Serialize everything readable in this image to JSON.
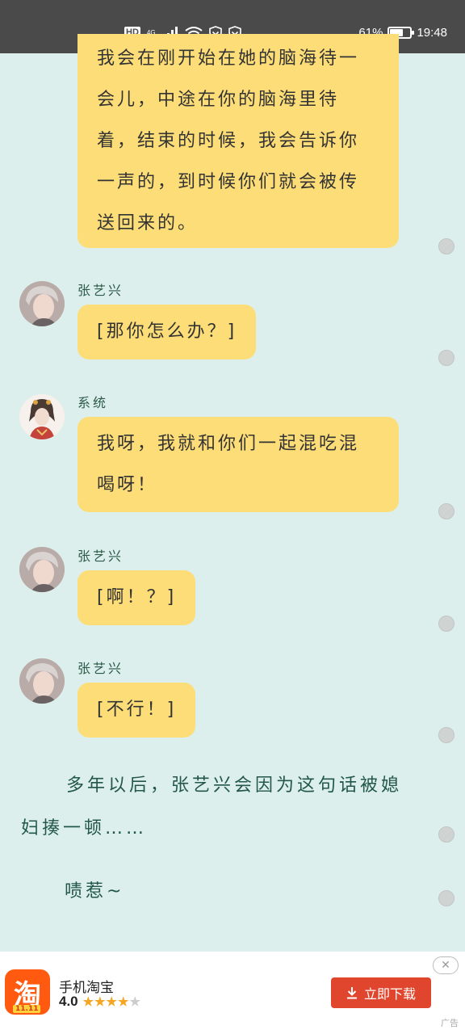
{
  "status_bar": {
    "hd": "HD",
    "network": "4G",
    "battery_text": "61%",
    "battery_level": 0.61,
    "time": "19:48"
  },
  "messages": [
    {
      "lines": [
        "我会在刚开始在她的脑海待一",
        "会儿，中途在你的脑海里待",
        "着，结束的时候，我会告诉你",
        "一声的，到时候你们就会被传",
        "送回来的。"
      ]
    },
    {
      "sender": "张艺兴",
      "lines": [
        "[那你怎么办？]"
      ]
    },
    {
      "sender": "系统",
      "lines": [
        "我呀，我就和你们一起混吃混",
        "喝呀！"
      ]
    },
    {
      "sender": "张艺兴",
      "lines": [
        "[啊！？]"
      ]
    },
    {
      "sender": "张艺兴",
      "lines": [
        "[不行！]"
      ]
    }
  ],
  "narration": {
    "para1_line1": "多年以后，张艺兴会因为这句话被媳",
    "para1_line2": "妇揍一顿……",
    "para2": "啧惹~"
  },
  "ad": {
    "app_name": "手机淘宝",
    "rating": "4.0",
    "rating_value": 4,
    "icon_glyph": "淘",
    "icon_tag": "11.11",
    "download_label": "立即下载",
    "close_label": "✕",
    "ad_label": "广告"
  }
}
